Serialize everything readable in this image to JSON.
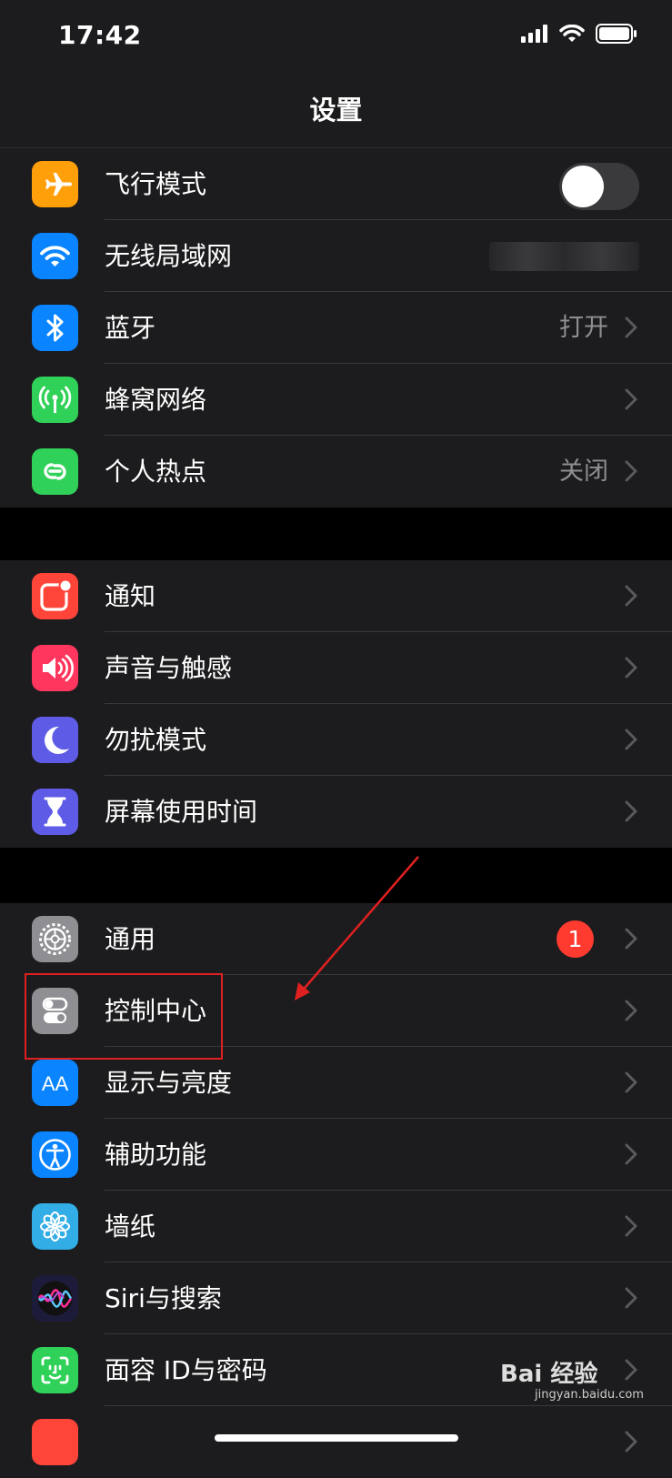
{
  "status": {
    "time": "17:42"
  },
  "nav": {
    "title": "设置"
  },
  "groups": [
    [
      {
        "label": "飞行模式",
        "icon": "airplane-icon",
        "color": "#ff9f0a",
        "accessory": "toggle",
        "toggle_on": false
      },
      {
        "label": "无线局域网",
        "icon": "wifi-icon",
        "color": "#0a84ff",
        "accessory": "blurred"
      },
      {
        "label": "蓝牙",
        "icon": "bluetooth-icon",
        "color": "#0a84ff",
        "accessory": "chevron",
        "value": "打开"
      },
      {
        "label": "蜂窝网络",
        "icon": "cellular-icon",
        "color": "#30d158",
        "accessory": "chevron"
      },
      {
        "label": "个人热点",
        "icon": "hotspot-icon",
        "color": "#30d158",
        "accessory": "chevron",
        "value": "关闭"
      }
    ],
    [
      {
        "label": "通知",
        "icon": "notification-icon",
        "color": "#ff453a",
        "accessory": "chevron"
      },
      {
        "label": "声音与触感",
        "icon": "sound-icon",
        "color": "#ff375f",
        "accessory": "chevron"
      },
      {
        "label": "勿扰模式",
        "icon": "moon-icon",
        "color": "#5e5ce6",
        "accessory": "chevron"
      },
      {
        "label": "屏幕使用时间",
        "icon": "hourglass-icon",
        "color": "#5e5ce6",
        "accessory": "chevron"
      }
    ],
    [
      {
        "label": "通用",
        "icon": "gear-icon",
        "color": "#8e8e93",
        "accessory": "chevron",
        "badge": "1"
      },
      {
        "label": "控制中心",
        "icon": "control-center-icon",
        "color": "#8e8e93",
        "accessory": "chevron"
      },
      {
        "label": "显示与亮度",
        "icon": "display-icon",
        "color": "#0a84ff",
        "accessory": "chevron"
      },
      {
        "label": "辅助功能",
        "icon": "accessibility-icon",
        "color": "#0a84ff",
        "accessory": "chevron"
      },
      {
        "label": "墙纸",
        "icon": "wallpaper-icon",
        "color": "#32ade6",
        "accessory": "chevron"
      },
      {
        "label": "Siri与搜索",
        "icon": "siri-icon",
        "color": "#1c1c3a",
        "accessory": "chevron"
      },
      {
        "label": "面容 ID与密码",
        "icon": "face-id-icon",
        "color": "#30d158",
        "accessory": "chevron"
      },
      {
        "label": "",
        "icon": "sos-icon",
        "color": "#ff453a",
        "accessory": "chevron"
      }
    ]
  ],
  "annotation": {
    "highlight": "控制中心",
    "color": "#e02020"
  },
  "watermark": {
    "text": "Bai 经验",
    "url": "jingyan.baidu.com"
  }
}
